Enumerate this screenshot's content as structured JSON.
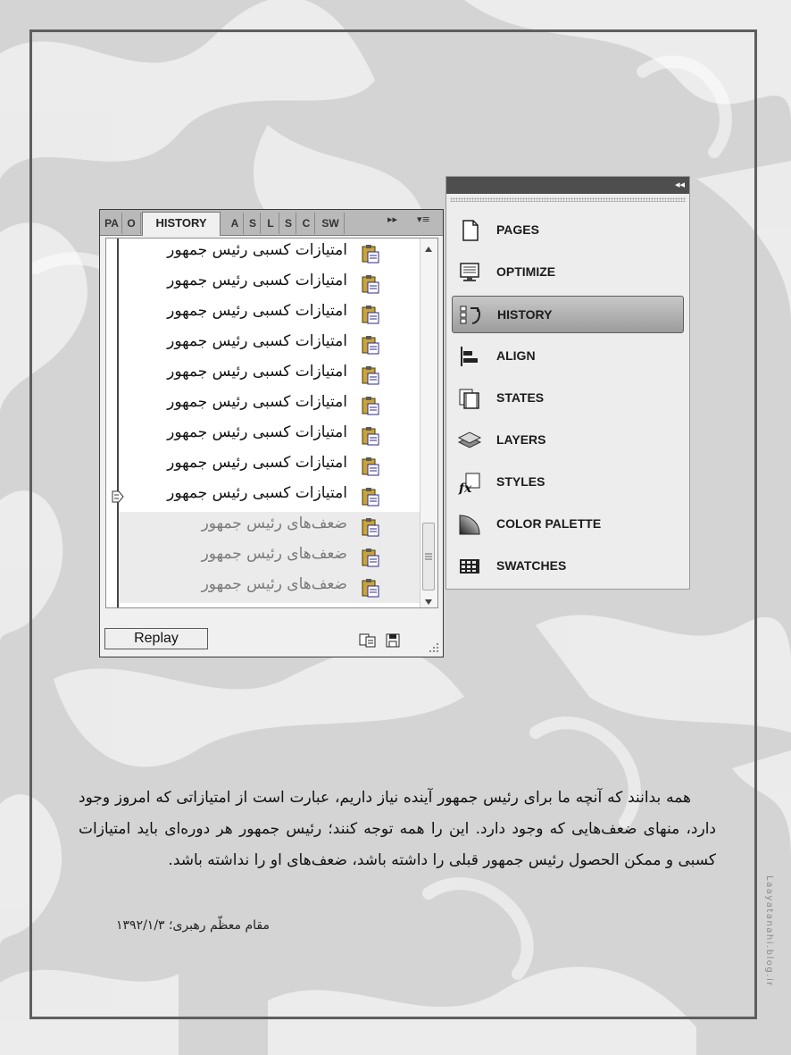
{
  "history_panel": {
    "tabs": {
      "pa": "PA",
      "o": "O",
      "history": "HISTORY",
      "a": "A",
      "s1": "S",
      "l": "L",
      "s2": "S",
      "c": "C",
      "sw": "SW"
    },
    "overflow_glyph": "▸▸",
    "menu_glyph": "▾≡",
    "items": [
      {
        "label": "امتیازات کسبی رئیس جمهور",
        "state": "done"
      },
      {
        "label": "امتیازات کسبی رئیس جمهور",
        "state": "done"
      },
      {
        "label": "امتیازات کسبی رئیس جمهور",
        "state": "done"
      },
      {
        "label": "امتیازات کسبی رئیس جمهور",
        "state": "done"
      },
      {
        "label": "امتیازات کسبی رئیس جمهور",
        "state": "done"
      },
      {
        "label": "امتیازات کسبی رئیس جمهور",
        "state": "done"
      },
      {
        "label": "امتیازات کسبی رئیس جمهور",
        "state": "done"
      },
      {
        "label": "امتیازات کسبی رئیس جمهور",
        "state": "done"
      },
      {
        "label": "امتیازات کسبی رئیس جمهور",
        "state": "current"
      },
      {
        "label": "ضعف‌های رئیس جمهور",
        "state": "undone"
      },
      {
        "label": "ضعف‌های رئیس جمهور",
        "state": "undone"
      },
      {
        "label": "ضعف‌های رئیس جمهور",
        "state": "undone"
      }
    ],
    "replay_label": "Replay",
    "icon_color": "#2a2a8a"
  },
  "right_panel": {
    "collapse_glyph": "◂◂",
    "items": [
      {
        "label": "PAGES",
        "icon": "pages-icon"
      },
      {
        "label": "OPTIMIZE",
        "icon": "optimize-icon"
      },
      {
        "label": "HISTORY",
        "icon": "history-icon",
        "selected": true
      },
      {
        "label": "ALIGN",
        "icon": "align-icon"
      },
      {
        "label": "STATES",
        "icon": "states-icon"
      },
      {
        "label": "LAYERS",
        "icon": "layers-icon"
      },
      {
        "label": "STYLES",
        "icon": "styles-icon"
      },
      {
        "label": "COLOR PALETTE",
        "icon": "color-palette-icon"
      },
      {
        "label": "SWATCHES",
        "icon": "swatches-icon"
      }
    ]
  },
  "quote": {
    "text": "همه بدانند که آنچه ما برای رئیس جمهور آینده نیاز داریم، عبارت است از امتیازاتی که امروز وجود دارد، منهای ضعف‌هایی که وجود دارد. این را همه توجه کنند؛ رئیس جمهور هر دوره‌ای باید امتیازات کسبی و ممکن الحصول رئیس جمهور قبلی را داشته باشد، ضعف‌های او را نداشته باشد.",
    "attribution": "مقام معظّم رهبری؛ ۱۳۹۲/۱/۳"
  },
  "watermark": "Laayatanahi.blog.ir"
}
